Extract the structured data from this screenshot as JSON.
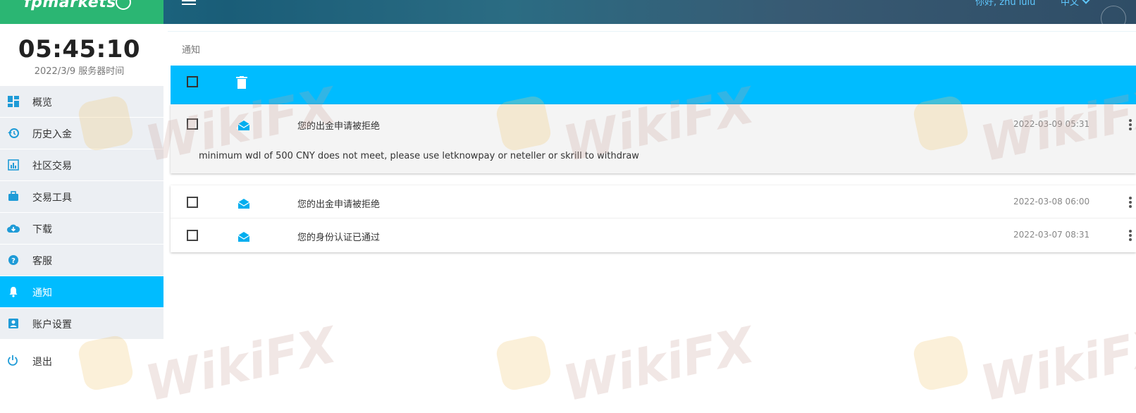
{
  "header": {
    "logo_text": "fpmarkets",
    "greeting": "你好, zhu lulu",
    "language": "中文"
  },
  "clock": {
    "time": "05:45:10",
    "server_time": "2022/3/9 服务器时间"
  },
  "sidebar": {
    "items": [
      {
        "label": "概览",
        "icon": "dashboard-icon"
      },
      {
        "label": "历史入金",
        "icon": "history-icon"
      },
      {
        "label": "社区交易",
        "icon": "chart-icon"
      },
      {
        "label": "交易工具",
        "icon": "briefcase-icon"
      },
      {
        "label": "下载",
        "icon": "cloud-download-icon"
      },
      {
        "label": "客服",
        "icon": "help-icon"
      },
      {
        "label": "通知",
        "icon": "bell-icon",
        "active": true
      },
      {
        "label": "账户设置",
        "icon": "account-icon"
      }
    ],
    "logout": "退出"
  },
  "main": {
    "breadcrumb": "通知",
    "notifications": [
      {
        "subject": "您的出金申请被拒绝",
        "date": "2022-03-09 05:31",
        "expanded": true,
        "detail": "minimum wdl of 500 CNY does not meet, please use letknowpay or neteller or skrill to withdraw"
      },
      {
        "subject": "您的出金申请被拒绝",
        "date": "2022-03-08 06:00"
      },
      {
        "subject": "您的身份认证已通过",
        "date": "2022-03-07 08:31"
      }
    ]
  },
  "watermark": "WikiFX",
  "colors": {
    "accent": "#00bcff",
    "brand_green": "#2bb673",
    "sidebar_bg": "#eceff3"
  }
}
